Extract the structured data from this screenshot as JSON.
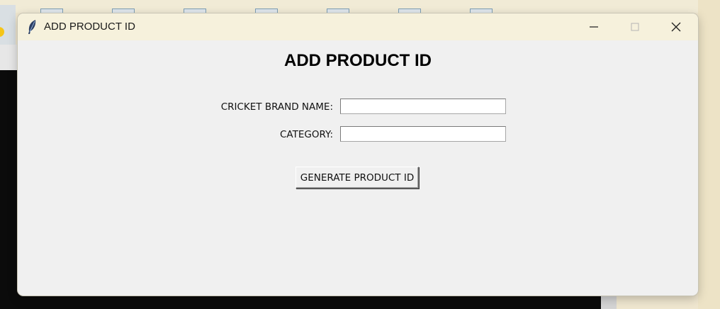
{
  "window": {
    "title": "ADD PRODUCT ID",
    "icon": "feather-icon",
    "controls": [
      "minimize-icon",
      "maximize-icon",
      "close-icon"
    ]
  },
  "form": {
    "heading": "ADD PRODUCT ID",
    "brand_label": "CRICKET BRAND NAME:",
    "brand_value": "",
    "category_label": "CATEGORY:",
    "category_value": "",
    "generate_button": "GENERATE PRODUCT ID"
  },
  "colors": {
    "titlebar": "#f6f1dc",
    "window_body": "#f0f0f0",
    "desktop": "#efe6cf"
  }
}
